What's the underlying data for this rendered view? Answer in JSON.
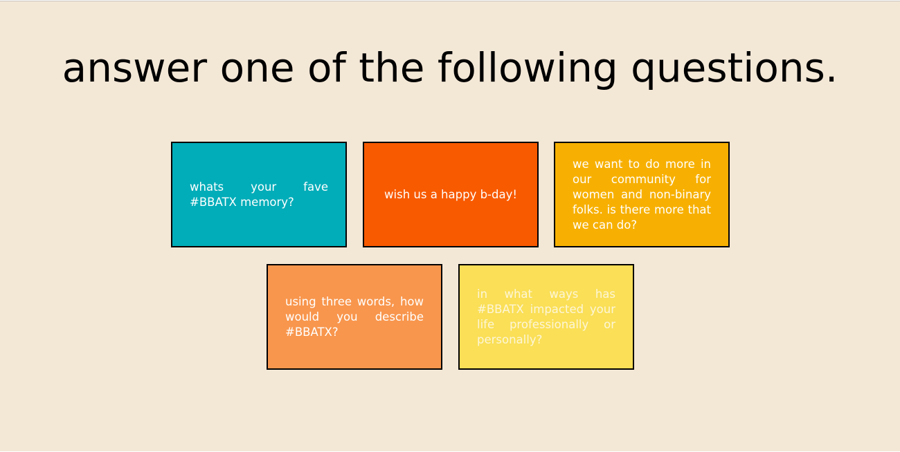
{
  "page": {
    "title": "answer one of the following questions.",
    "background_color": "#f3e7d6"
  },
  "cards": [
    {
      "text": "whats your fave #BBATX memory?",
      "bg_color": "#00adb9",
      "text_color": "#ffffff"
    },
    {
      "text": "wish us a happy b-day!",
      "bg_color": "#f85a00",
      "text_color": "#ffffff"
    },
    {
      "text": "we want to do more in our community for women and non-binary folks. is there more that we can do?",
      "bg_color": "#f7b001",
      "text_color": "#ffffff"
    },
    {
      "text": "using three words, how would you describe #BBATX?",
      "bg_color": "#f8964d",
      "text_color": "#ffffff"
    },
    {
      "text": "in what ways has #BBATX impacted your life professionally or personally?",
      "bg_color": "#fadf57",
      "text_color": "#fdf6d8"
    }
  ]
}
